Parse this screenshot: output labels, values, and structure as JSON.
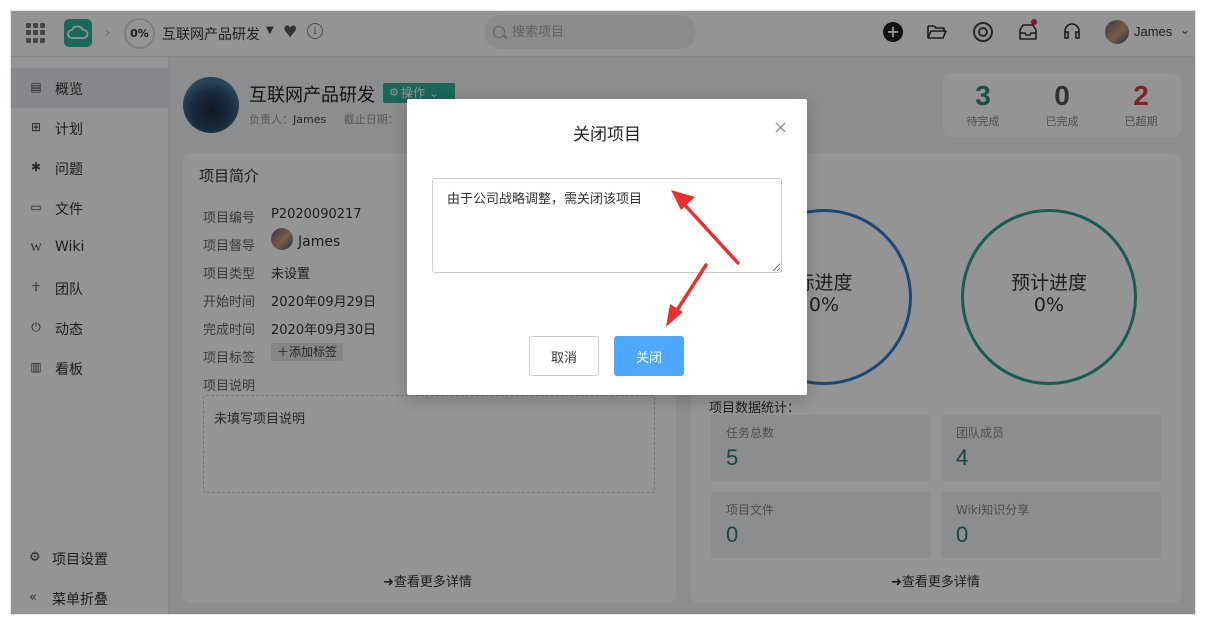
{
  "topbar": {
    "progress": "0%",
    "project_title": "互联网产品研发",
    "search_placeholder": "搜索项目",
    "user_name": "James"
  },
  "sidebar": {
    "items": [
      {
        "label": "概览",
        "icon": "overview-icon"
      },
      {
        "label": "计划",
        "icon": "plan-icon"
      },
      {
        "label": "问题",
        "icon": "bug-icon"
      },
      {
        "label": "文件",
        "icon": "folder-icon"
      },
      {
        "label": "Wiki",
        "icon": "wiki-icon"
      },
      {
        "label": "团队",
        "icon": "team-icon"
      },
      {
        "label": "动态",
        "icon": "activity-icon"
      },
      {
        "label": "看板",
        "icon": "board-icon"
      }
    ],
    "settings_label": "项目设置",
    "collapse_label": "菜单折叠"
  },
  "project": {
    "name": "互联网产品研发",
    "operation_label": "操作",
    "owner_label": "负责人：",
    "owner_name": "James",
    "deadline_label": "截止日期："
  },
  "stats": {
    "pending": {
      "value": "3",
      "label": "待完成",
      "color": "#2a8a7a"
    },
    "done": {
      "value": "0",
      "label": "已完成",
      "color": "#555555"
    },
    "overdue": {
      "value": "2",
      "label": "已超期",
      "color": "#e23b3b"
    }
  },
  "intro": {
    "title": "项目简介",
    "fields": [
      {
        "label": "项目编号",
        "value": "P2020090217"
      },
      {
        "label": "项目督导",
        "value": "James"
      },
      {
        "label": "项目类型",
        "value": "未设置"
      },
      {
        "label": "开始时间",
        "value": "2020年09月29日"
      },
      {
        "label": "完成时间",
        "value": "2020年09月30日"
      },
      {
        "label": "项目标签",
        "value": "＋添加标签"
      },
      {
        "label": "项目说明",
        "value": ""
      }
    ],
    "description": "未填写项目说明",
    "more_link": "查看更多详情"
  },
  "progress": {
    "actual_label": "际进度",
    "actual_value": "0%",
    "planned_label": "预计进度",
    "planned_value": "0%",
    "stats_title": "项目数据统计：",
    "tiles": [
      {
        "label": "任务总数",
        "value": "5"
      },
      {
        "label": "团队成员",
        "value": "4"
      },
      {
        "label": "项目文件",
        "value": "0"
      },
      {
        "label": "Wiki知识分享",
        "value": "0"
      }
    ],
    "more_link": "查看更多详情"
  },
  "modal": {
    "title": "关闭项目",
    "reason_text": "由于公司战略调整，需关闭该项目",
    "cancel_label": "取消",
    "confirm_label": "关闭"
  },
  "colors": {
    "brand": "#2bb39a",
    "primary_button": "#4ea8ff",
    "arrow": "#e8312f",
    "actual_ring": "#2e7bd6",
    "planned_ring": "#26a38e"
  }
}
